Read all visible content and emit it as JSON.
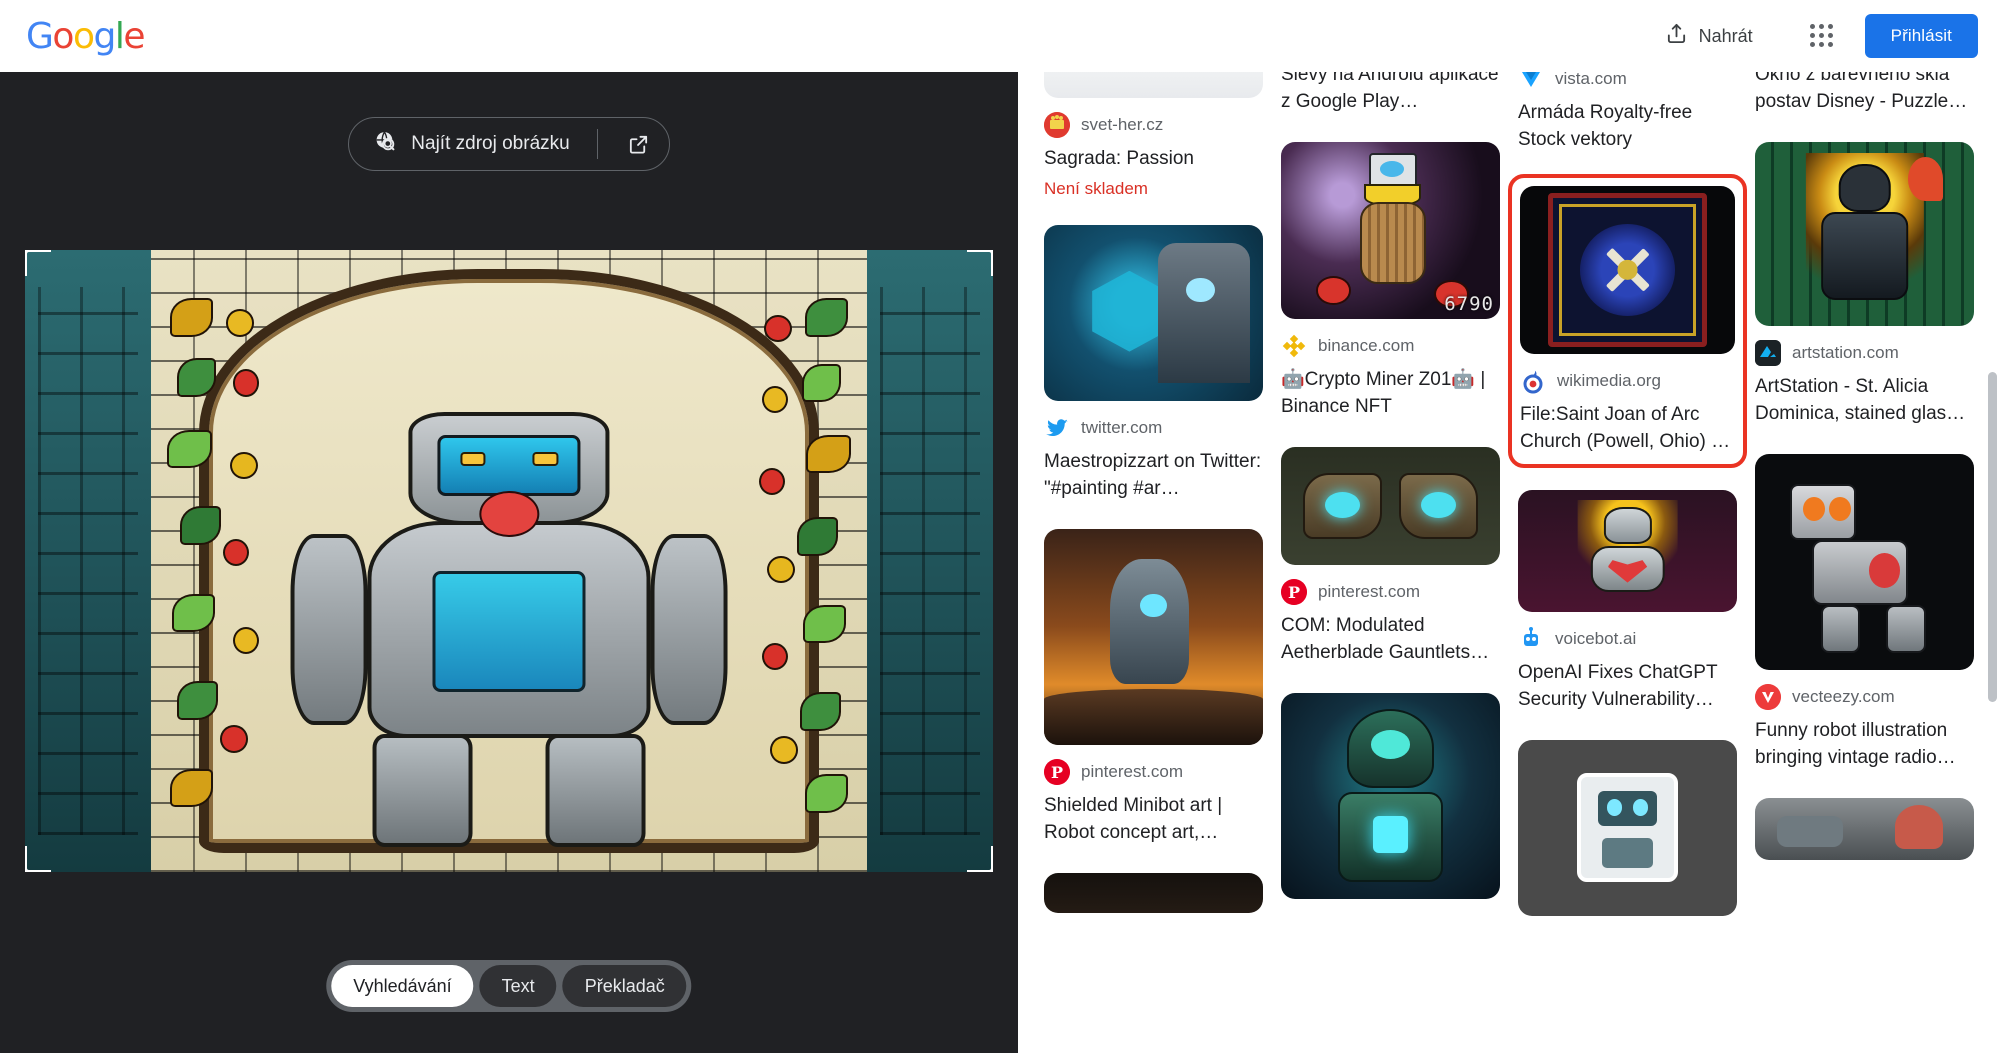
{
  "header": {
    "logo_letters": [
      "G",
      "o",
      "o",
      "g",
      "l",
      "e"
    ],
    "upload_label": "Nahrát",
    "upload_icon": "upload-icon",
    "apps_icon": "apps-grid-icon",
    "signin_label": "Přihlásit",
    "accent_color": "#1a73e8"
  },
  "left_panel": {
    "source_button": {
      "label": "Najít zdroj obrázku",
      "leading_icon": "globe-search-icon",
      "trailing_icon": "external-link-icon"
    },
    "image_alt": "Stained glass window depicting a robot knight",
    "crop_handles": [
      "top-left",
      "top-right",
      "bottom-left",
      "bottom-right"
    ],
    "mode_tabs": [
      {
        "label": "Vyhledávání",
        "active": true
      },
      {
        "label": "Text",
        "active": false
      },
      {
        "label": "Překladač",
        "active": false
      }
    ]
  },
  "results": {
    "columns": [
      {
        "cards": [
          {
            "source": "svet-her.cz",
            "favicon": "svet-her-icon",
            "favicon_color": "#e03a2f",
            "title": "Sagrada: Passion",
            "status": "Není skladem",
            "status_color": "#d93025",
            "thumb": "partial-top",
            "thumb_height": 34,
            "art": "plain"
          },
          {
            "source": "twitter.com",
            "favicon": "twitter-icon",
            "favicon_color": "#1d9bf0",
            "title": "Maestropizzart on Twitter: \"#painting #ar…",
            "thumb_height": 176,
            "art": "blue-hex"
          },
          {
            "source": "pinterest.com",
            "favicon": "pinterest-icon",
            "favicon_color": "#e60023",
            "title": "Shielded Minibot art | Robot concept art,…",
            "thumb_height": 216,
            "art": "sunset-mech"
          },
          {
            "source": "",
            "favicon": "",
            "title": "",
            "thumb_height": 40,
            "art": "dark-cut"
          }
        ]
      },
      {
        "cards": [
          {
            "source": "",
            "favicon": "",
            "title": "Slevy na Android aplikace z Google Play…",
            "thumb_height": 0,
            "art": "none"
          },
          {
            "source": "binance.com",
            "favicon": "binance-icon",
            "favicon_color": "#f0b90b",
            "title": "🤖Crypto Miner Z01🤖 | Binance NFT",
            "thumb_height": 177,
            "art": "barrel-bot",
            "badge": "6790"
          },
          {
            "source": "pinterest.com",
            "favicon": "pinterest-icon",
            "favicon_color": "#e60023",
            "title": "COM: Modulated Aetherblade Gauntlets…",
            "thumb_height": 118,
            "art": "gauntlets"
          },
          {
            "source": "",
            "favicon": "",
            "title": "",
            "thumb_height": 206,
            "art": "teal-mech"
          }
        ]
      },
      {
        "cards": [
          {
            "source": "vista.com",
            "favicon": "vista-icon",
            "favicon_color": "#1aa3ff",
            "title": "Armáda Royalty-free Stock vektory",
            "thumb_height": 0,
            "art": "none"
          },
          {
            "source": "wikimedia.org",
            "favicon": "wikimedia-icon",
            "favicon_color": "#3366cc",
            "title": "File:Saint Joan of Arc Church (Powell, Ohio) …",
            "thumb_height": 168,
            "art": "rose-window",
            "highlighted": true
          },
          {
            "source": "voicebot.ai",
            "favicon": "voicebot-icon",
            "favicon_color": "#2196f3",
            "title": "OpenAI Fixes ChatGPT Security Vulnerability…",
            "thumb_height": 122,
            "art": "heart-bot"
          },
          {
            "source": "",
            "favicon": "",
            "title": "",
            "thumb_height": 176,
            "art": "sticker-bot"
          }
        ]
      },
      {
        "cards": [
          {
            "source": "",
            "favicon": "",
            "title": "Okno z barevného skla postav Disney - Puzzle…",
            "thumb_height": 0,
            "art": "none"
          },
          {
            "source": "artstation.com",
            "favicon": "artstation-icon",
            "favicon_color": "#13aff0",
            "title": "ArtStation - St. Alicia Dominica, stained glas…",
            "thumb_height": 184,
            "art": "knight-glass"
          },
          {
            "source": "vecteezy.com",
            "favicon": "vecteezy-icon",
            "favicon_color": "#ed3b3b",
            "title": "Funny robot illustration bringing vintage radio…",
            "thumb_height": 216,
            "art": "red-robot"
          },
          {
            "source": "",
            "favicon": "",
            "title": "",
            "thumb_height": 62,
            "art": "photo-cut"
          }
        ]
      }
    ]
  }
}
